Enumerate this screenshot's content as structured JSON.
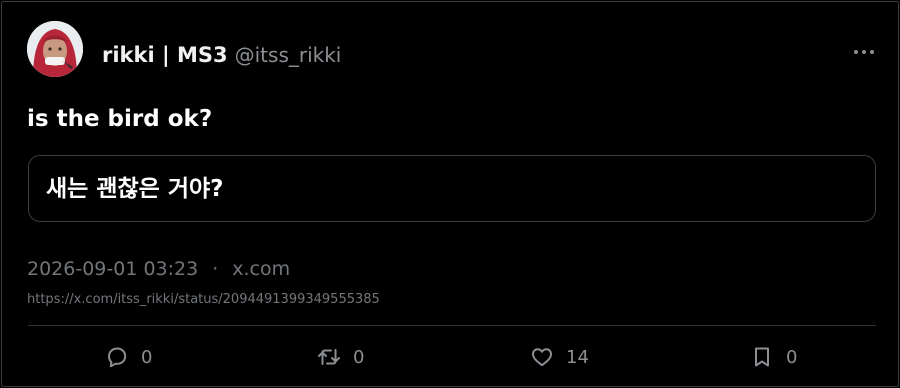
{
  "author": {
    "display_name": "rikki | MS3",
    "handle": "@itss_rikki",
    "avatar_icon": "profile-photo"
  },
  "tweet": {
    "text": "is the bird ok?",
    "translation": "새는 괜찮은 거야?"
  },
  "meta": {
    "timestamp": "2026-09-01 03:23",
    "separator": "·",
    "source": "x.com",
    "url": "https://x.com/itss_rikki/status/2094491399349555385"
  },
  "actions": {
    "reply": {
      "icon": "reply-icon",
      "count": "0"
    },
    "repost": {
      "icon": "repost-icon",
      "count": "0"
    },
    "like": {
      "icon": "heart-icon",
      "count": "14"
    },
    "bookmark": {
      "icon": "bookmark-icon",
      "count": "0"
    }
  },
  "colors": {
    "background": "#000000",
    "text": "#e7e9ea",
    "muted": "#72767a",
    "border": "#3a3d40"
  }
}
